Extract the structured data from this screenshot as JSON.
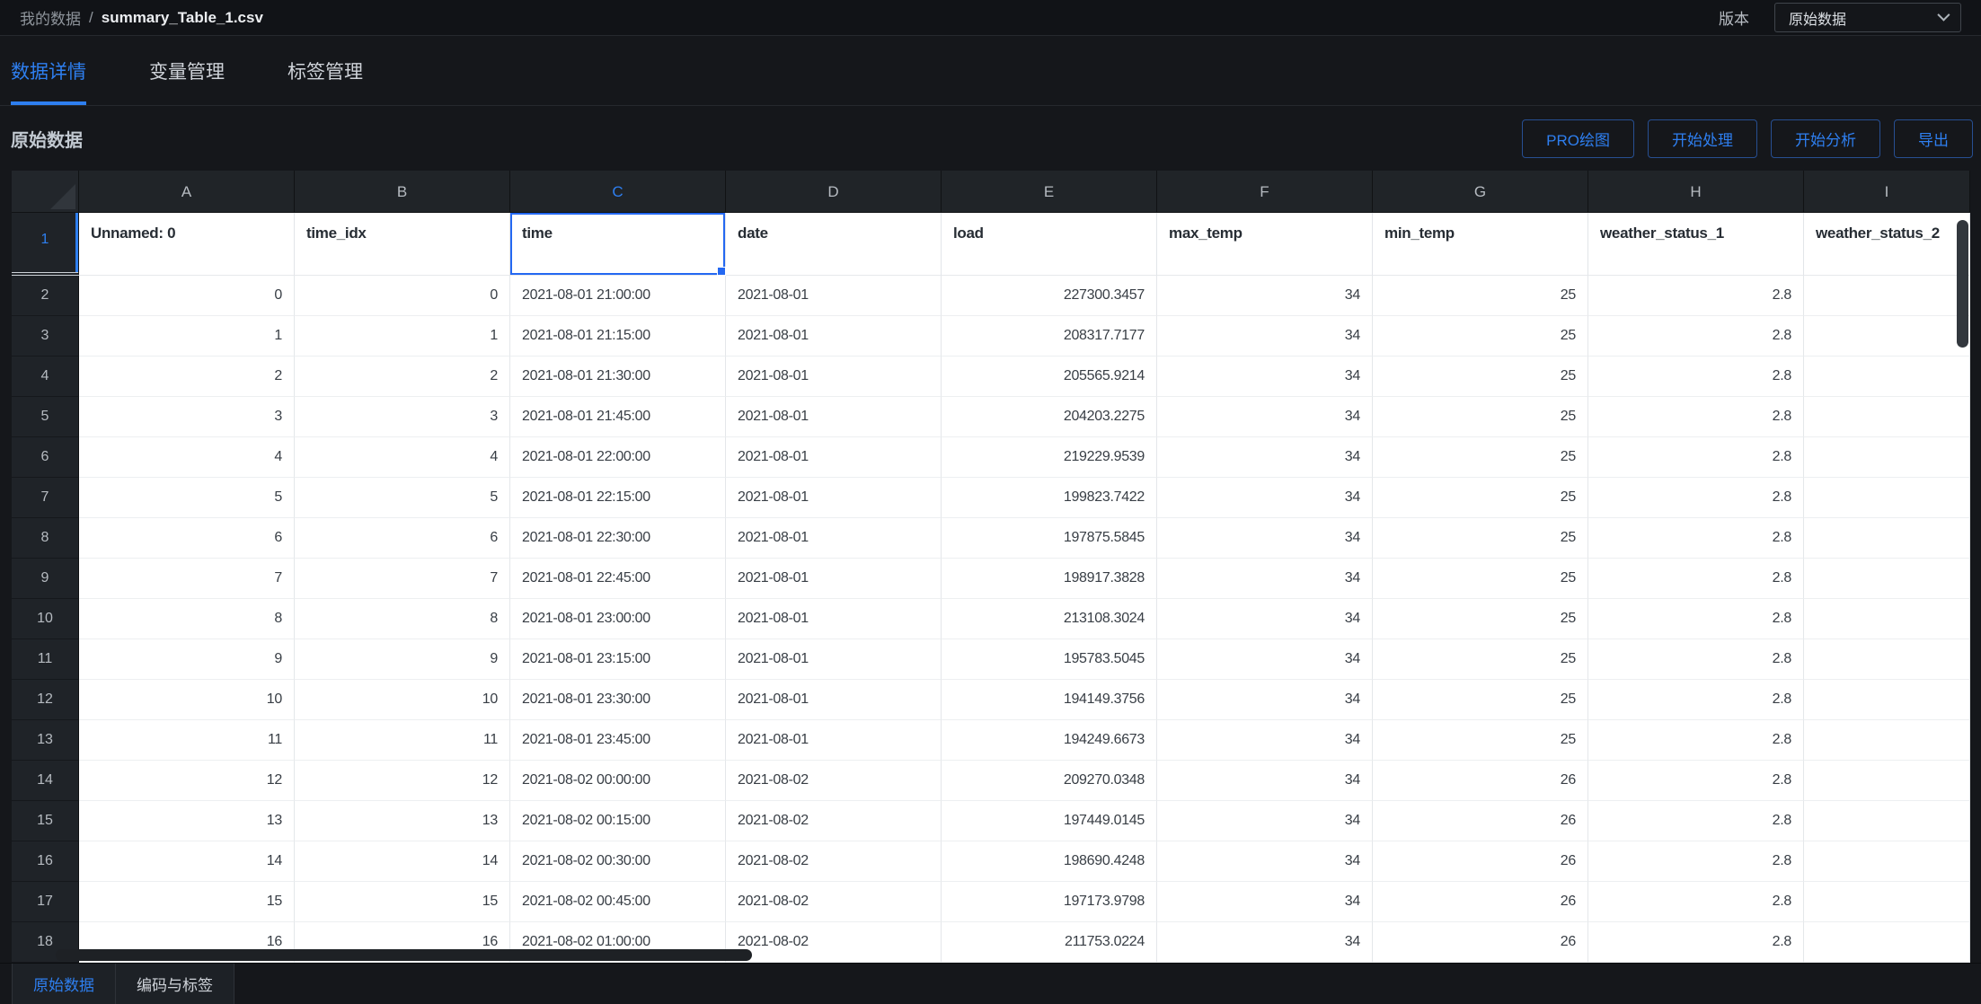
{
  "topbar": {
    "breadcrumb_root": "我的数据",
    "breadcrumb_sep": "/",
    "file_name": "summary_Table_1.csv",
    "version_label": "版本",
    "version_value": "原始数据"
  },
  "nav_tabs": [
    {
      "label": "数据详情",
      "active": true
    },
    {
      "label": "变量管理",
      "active": false
    },
    {
      "label": "标签管理",
      "active": false
    }
  ],
  "section": {
    "title": "原始数据",
    "buttons": [
      "PRO绘图",
      "开始处理",
      "开始分析",
      "导出"
    ]
  },
  "sheet": {
    "columns": [
      "A",
      "B",
      "C",
      "D",
      "E",
      "F",
      "G",
      "H",
      "I"
    ],
    "selected_column": "C",
    "selected_row": 1,
    "header_row": {
      "row_num": "1",
      "fields": [
        "Unnamed: 0",
        "time_idx",
        "time",
        "date",
        "load",
        "max_temp",
        "min_temp",
        "weather_status_1",
        "weather_status_2"
      ],
      "selected_field": "time"
    },
    "rows": [
      {
        "n": "2",
        "cells": [
          "0",
          "0",
          "2021-08-01 21:00:00",
          "2021-08-01",
          "227300.3457",
          "34",
          "25",
          "2.8",
          ""
        ]
      },
      {
        "n": "3",
        "cells": [
          "1",
          "1",
          "2021-08-01 21:15:00",
          "2021-08-01",
          "208317.7177",
          "34",
          "25",
          "2.8",
          ""
        ]
      },
      {
        "n": "4",
        "cells": [
          "2",
          "2",
          "2021-08-01 21:30:00",
          "2021-08-01",
          "205565.9214",
          "34",
          "25",
          "2.8",
          ""
        ]
      },
      {
        "n": "5",
        "cells": [
          "3",
          "3",
          "2021-08-01 21:45:00",
          "2021-08-01",
          "204203.2275",
          "34",
          "25",
          "2.8",
          ""
        ]
      },
      {
        "n": "6",
        "cells": [
          "4",
          "4",
          "2021-08-01 22:00:00",
          "2021-08-01",
          "219229.9539",
          "34",
          "25",
          "2.8",
          ""
        ]
      },
      {
        "n": "7",
        "cells": [
          "5",
          "5",
          "2021-08-01 22:15:00",
          "2021-08-01",
          "199823.7422",
          "34",
          "25",
          "2.8",
          ""
        ]
      },
      {
        "n": "8",
        "cells": [
          "6",
          "6",
          "2021-08-01 22:30:00",
          "2021-08-01",
          "197875.5845",
          "34",
          "25",
          "2.8",
          ""
        ]
      },
      {
        "n": "9",
        "cells": [
          "7",
          "7",
          "2021-08-01 22:45:00",
          "2021-08-01",
          "198917.3828",
          "34",
          "25",
          "2.8",
          ""
        ]
      },
      {
        "n": "10",
        "cells": [
          "8",
          "8",
          "2021-08-01 23:00:00",
          "2021-08-01",
          "213108.3024",
          "34",
          "25",
          "2.8",
          ""
        ]
      },
      {
        "n": "11",
        "cells": [
          "9",
          "9",
          "2021-08-01 23:15:00",
          "2021-08-01",
          "195783.5045",
          "34",
          "25",
          "2.8",
          ""
        ]
      },
      {
        "n": "12",
        "cells": [
          "10",
          "10",
          "2021-08-01 23:30:00",
          "2021-08-01",
          "194149.3756",
          "34",
          "25",
          "2.8",
          ""
        ]
      },
      {
        "n": "13",
        "cells": [
          "11",
          "11",
          "2021-08-01 23:45:00",
          "2021-08-01",
          "194249.6673",
          "34",
          "25",
          "2.8",
          ""
        ]
      },
      {
        "n": "14",
        "cells": [
          "12",
          "12",
          "2021-08-02 00:00:00",
          "2021-08-02",
          "209270.0348",
          "34",
          "26",
          "2.8",
          ""
        ]
      },
      {
        "n": "15",
        "cells": [
          "13",
          "13",
          "2021-08-02 00:15:00",
          "2021-08-02",
          "197449.0145",
          "34",
          "26",
          "2.8",
          ""
        ]
      },
      {
        "n": "16",
        "cells": [
          "14",
          "14",
          "2021-08-02 00:30:00",
          "2021-08-02",
          "198690.4248",
          "34",
          "26",
          "2.8",
          ""
        ]
      },
      {
        "n": "17",
        "cells": [
          "15",
          "15",
          "2021-08-02 00:45:00",
          "2021-08-02",
          "197173.9798",
          "34",
          "26",
          "2.8",
          ""
        ]
      },
      {
        "n": "18",
        "cells": [
          "16",
          "16",
          "2021-08-02 01:00:00",
          "2021-08-02",
          "211753.0224",
          "34",
          "26",
          "2.8",
          ""
        ]
      }
    ]
  },
  "sheet_tabs": [
    {
      "label": "原始数据",
      "active": true
    },
    {
      "label": "编码与标签",
      "active": false
    }
  ],
  "colors": {
    "accent": "#2e7ff0",
    "selection_border": "#2468f2",
    "cell_background": "#ffffff",
    "header_background": "#202428",
    "page_background": "#15171b"
  }
}
